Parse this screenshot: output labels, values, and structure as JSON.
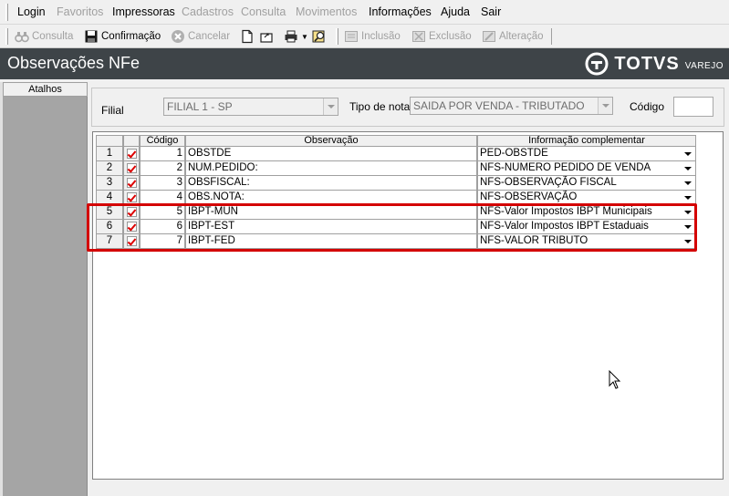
{
  "menu": {
    "items": [
      {
        "label": "Login",
        "enabled": true
      },
      {
        "label": "Favoritos",
        "enabled": false
      },
      {
        "label": "Impressoras",
        "enabled": true
      },
      {
        "label": "Cadastros",
        "enabled": false
      },
      {
        "label": "Consulta",
        "enabled": false
      },
      {
        "label": "Movimentos",
        "enabled": false
      },
      {
        "label": "Informações",
        "enabled": true
      },
      {
        "label": "Ajuda",
        "enabled": true
      },
      {
        "label": "Sair",
        "enabled": true
      }
    ]
  },
  "toolbar": {
    "consulta": "Consulta",
    "confirmacao": "Confirmação",
    "cancelar": "Cancelar",
    "inclusao": "Inclusão",
    "exclusao": "Exclusão",
    "alteracao": "Alteração"
  },
  "header": {
    "title": "Observações NFe",
    "logo_word": "TOTVS",
    "logo_sub": "VAREJO"
  },
  "sidebar": {
    "title": "Atalhos"
  },
  "filters": {
    "filial_label": "Filial",
    "filial_value": "FILIAL 1 - SP",
    "tipo_label": "Tipo de nota",
    "tipo_value": "SAIDA POR VENDA - TRIBUTADO",
    "codigo_label": "Código",
    "codigo_value": ""
  },
  "grid": {
    "headers": {
      "codigo": "Código",
      "observacao": "Observação",
      "info": "Informação complementar"
    },
    "rows": [
      {
        "n": "1",
        "codigo": "1",
        "obs": "OBSTDE",
        "info": "PED-OBSTDE"
      },
      {
        "n": "2",
        "codigo": "2",
        "obs": "NUM.PEDIDO:",
        "info": "NFS-NUMERO PEDIDO DE VENDA"
      },
      {
        "n": "3",
        "codigo": "3",
        "obs": "OBSFISCAL:",
        "info": "NFS-OBSERVAÇÃO FISCAL"
      },
      {
        "n": "4",
        "codigo": "4",
        "obs": "OBS.NOTA:",
        "info": "NFS-OBSERVAÇÃO"
      },
      {
        "n": "5",
        "codigo": "5",
        "obs": "IBPT-MUN",
        "info": "NFS-Valor Impostos IBPT Municipais"
      },
      {
        "n": "6",
        "codigo": "6",
        "obs": "IBPT-EST",
        "info": "NFS-Valor Impostos IBPT Estaduais"
      },
      {
        "n": "7",
        "codigo": "7",
        "obs": "IBPT-FED",
        "info": "NFS-VALOR TRIBUTO"
      }
    ]
  },
  "colors": {
    "title_bar": "#3e4448",
    "highlight": "#d40000",
    "check": "#dd0000"
  }
}
